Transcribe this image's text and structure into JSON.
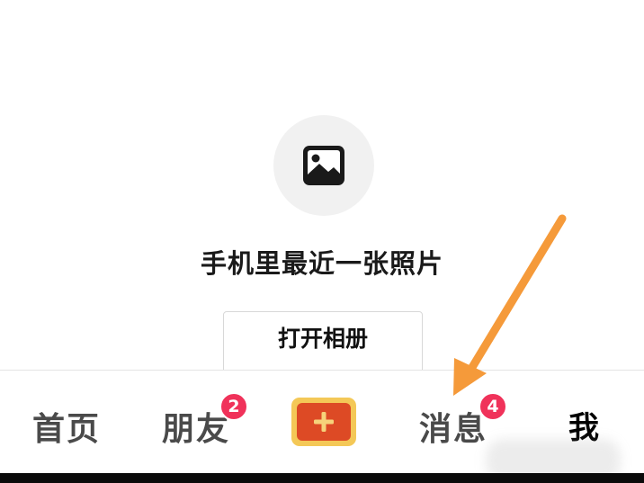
{
  "upload": {
    "image_icon": "image-icon",
    "prompt": "手机里最近一张照片",
    "open_album_label": "打开相册"
  },
  "tab_bar": {
    "home": "首页",
    "friends": "朋友",
    "friends_badge": "2",
    "create_icon": "plus-icon",
    "messages": "消息",
    "messages_badge": "4",
    "me": "我"
  },
  "colors": {
    "badge": "#f0325a",
    "create_outer": "#f4c857",
    "create_inner": "#dd4a25",
    "annotation_arrow": "#f59a3a"
  }
}
